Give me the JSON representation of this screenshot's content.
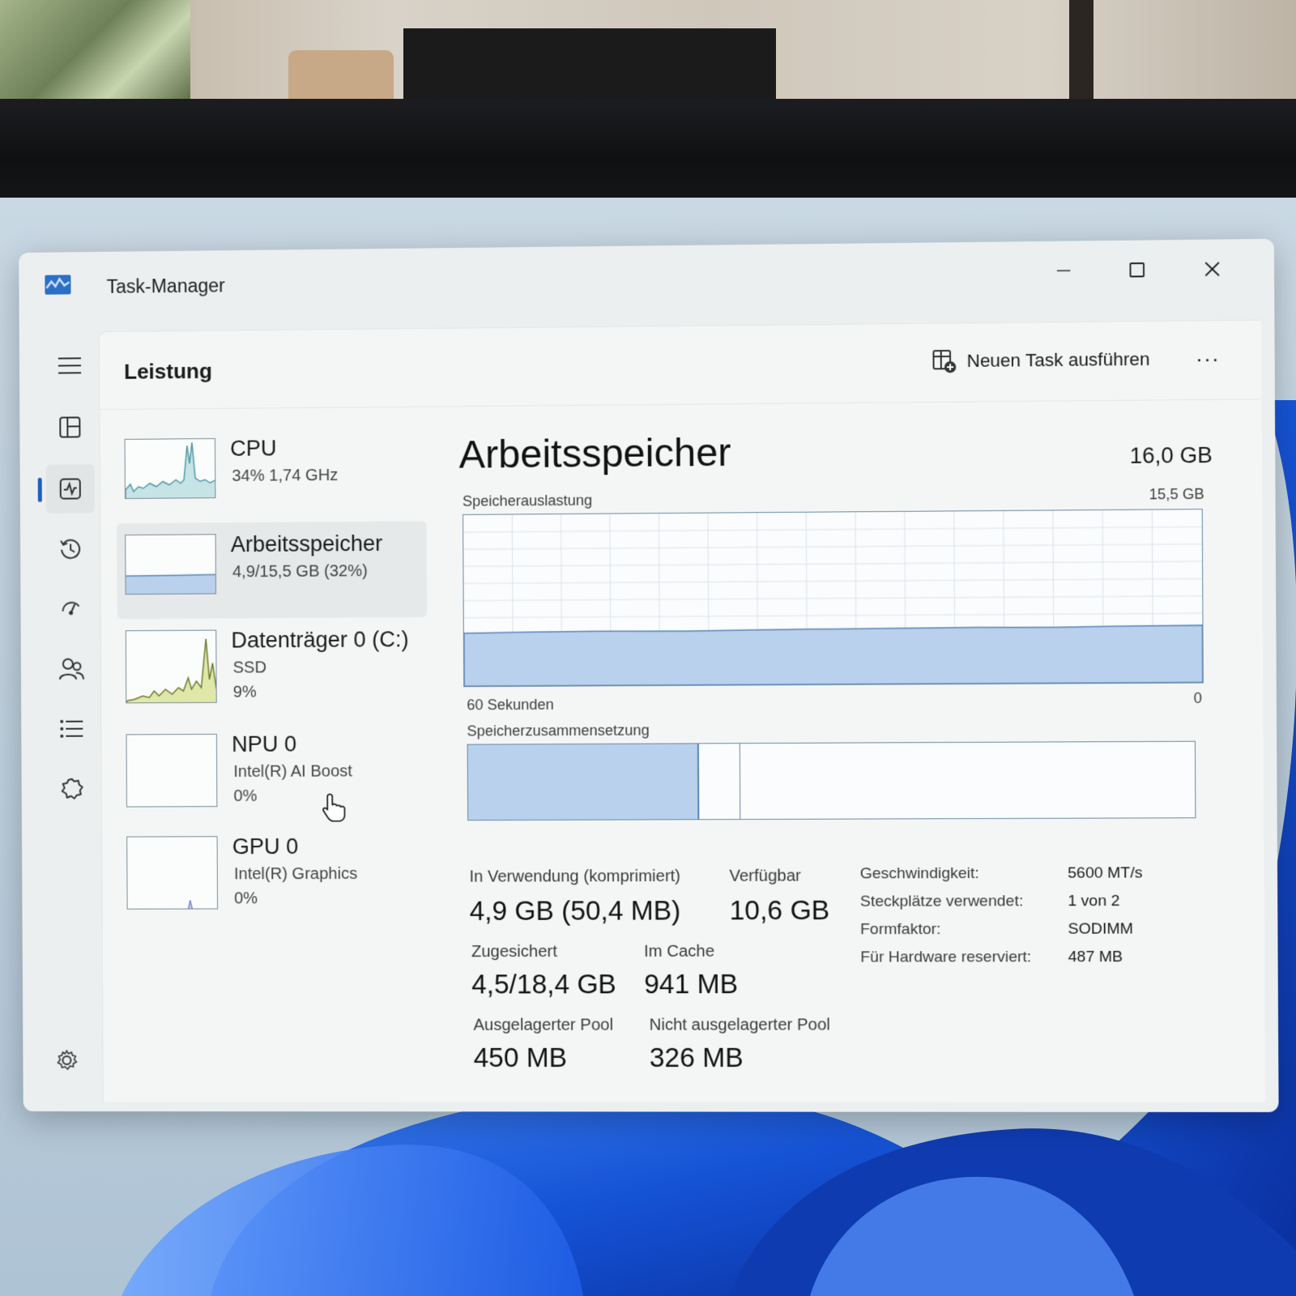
{
  "window": {
    "title": "Task-Manager"
  },
  "header": {
    "page_title": "Leistung",
    "run_task_label": "Neuen Task ausführen",
    "more_label": "···"
  },
  "nav": [
    {
      "icon": "hamburger-menu-icon"
    },
    {
      "icon": "processes-icon"
    },
    {
      "icon": "performance-icon",
      "active": true
    },
    {
      "icon": "app-history-icon"
    },
    {
      "icon": "startup-apps-icon"
    },
    {
      "icon": "users-icon"
    },
    {
      "icon": "details-icon"
    },
    {
      "icon": "services-icon"
    }
  ],
  "perf_list": [
    {
      "name": "CPU",
      "sub1": "34%  1,74 GHz",
      "sub2": ""
    },
    {
      "name": "Arbeitsspeicher",
      "sub1": "4,9/15,5 GB (32%)",
      "sub2": ""
    },
    {
      "name": "Datenträger 0 (C:)",
      "sub1": "SSD",
      "sub2": "9%"
    },
    {
      "name": "NPU 0",
      "sub1": "Intel(R) AI Boost",
      "sub2": "0%"
    },
    {
      "name": "GPU 0",
      "sub1": "Intel(R) Graphics",
      "sub2": "0%"
    }
  ],
  "detail": {
    "title": "Arbeitsspeicher",
    "total": "16,0 GB",
    "usage_label": "Speicherauslastung",
    "usage_max": "15,5 GB",
    "time_left": "60 Sekunden",
    "time_right": "0",
    "composition_label": "Speicherzusammensetzung",
    "composition": {
      "in_use_fraction": 0.32,
      "modified_fraction": 0.057
    },
    "usage_fraction": 0.31,
    "stats": {
      "in_use_label": "In Verwendung (komprimiert)",
      "in_use_value": "4,9 GB (50,4 MB)",
      "available_label": "Verfügbar",
      "available_value": "10,6 GB",
      "committed_label": "Zugesichert",
      "committed_value": "4,5/18,4 GB",
      "cached_label": "Im Cache",
      "cached_value": "941 MB",
      "paged_label": "Ausgelagerter Pool",
      "paged_value": "450 MB",
      "nonpaged_label": "Nicht ausgelagerter Pool",
      "nonpaged_value": "326 MB"
    },
    "specs": [
      {
        "label": "Geschwindigkeit:",
        "value": "5600 MT/s"
      },
      {
        "label": "Steckplätze verwendet:",
        "value": "1 von 2"
      },
      {
        "label": "Formfaktor:",
        "value": "SODIMM"
      },
      {
        "label": "Für Hardware reserviert:",
        "value": "487 MB"
      }
    ]
  },
  "colors": {
    "memory_fill": "#b9d1ec",
    "memory_line": "#5a86b8",
    "cpu_fill": "#c6e3e6",
    "disk_fill": "#dfe8a8",
    "accent": "#1f5fbf"
  }
}
